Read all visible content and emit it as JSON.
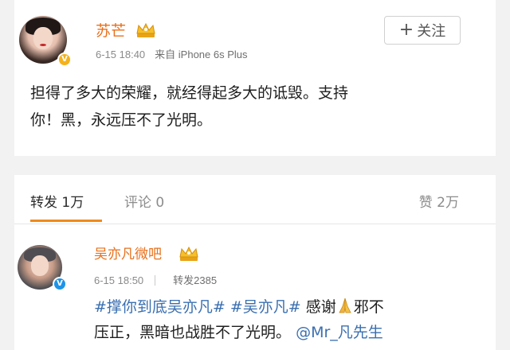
{
  "post": {
    "author": "苏芒",
    "time": "6-15 18:40",
    "source": "来自 iPhone 6s Plus",
    "follow_label": "关注",
    "text_line1": "担得了多大的荣耀，就经得起多大的诋毁。支持",
    "text_line2": "你！黑，永远压不了光明。"
  },
  "tabs": {
    "repost": "转发 1万",
    "comment": "评论 0",
    "like": "赞 2万"
  },
  "repost_item": {
    "author": "吴亦凡微吧",
    "time": "6-15 18:50",
    "repost_count": "转发2385",
    "tag1": "#撑你到底吴亦凡#",
    "tag2": "#吴亦凡#",
    "text_a": " 感谢",
    "text_b": "邪不",
    "text_line2": "压正，黑暗也战胜不了光明。",
    "mention": "@Mr_凡先生"
  },
  "icons": {
    "crown": "crown-icon",
    "verified": "verified-badge-icon",
    "pray": "pray-hands-icon",
    "plus": "plus-icon"
  },
  "colors": {
    "username": "#e8701c",
    "link": "#3a6fb0",
    "tab_accent": "#f08a1c"
  }
}
